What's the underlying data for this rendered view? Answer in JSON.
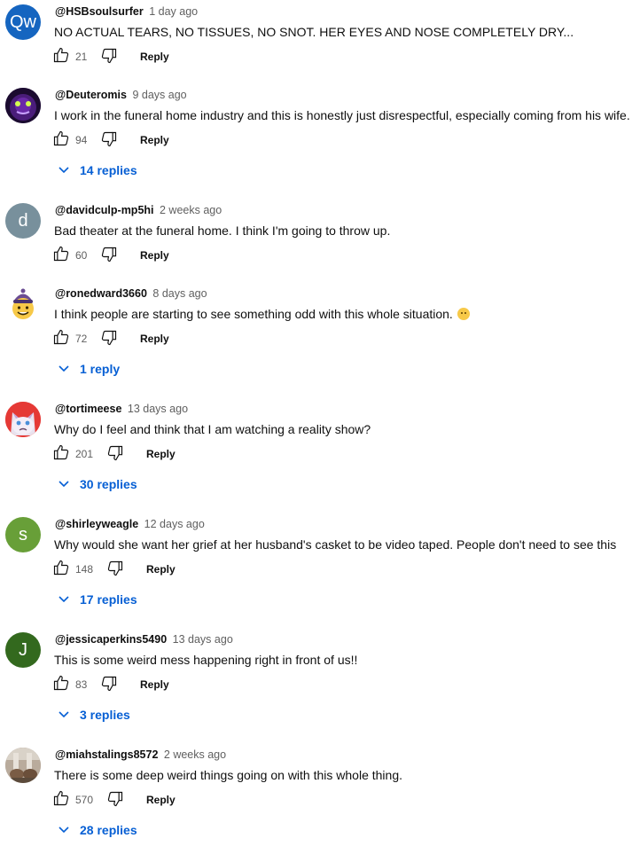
{
  "comments": [
    {
      "author": "@HSBsoulsurfer",
      "time": "1 day ago",
      "text": "NO ACTUAL TEARS, NO TISSUES, NO SNOT. HER EYES AND NOSE COMPLETELY DRY...",
      "likes": "21",
      "reply_label": "Reply",
      "replies": "",
      "avatar_letter": "Qw",
      "avatar_color": "#1565c0"
    },
    {
      "author": "@Deuteromis",
      "time": "9 days ago",
      "text": "I work in the funeral home industry and this is honestly just disrespectful, especially coming from his wife.",
      "likes": "94",
      "reply_label": "Reply",
      "replies": "14 replies",
      "avatar_letter": "",
      "avatar_color": "#2a1147"
    },
    {
      "author": "@davidculp-mp5hi",
      "time": "2 weeks ago",
      "text": "Bad theater at the funeral home. I think I'm going to throw up.",
      "likes": "60",
      "reply_label": "Reply",
      "replies": "",
      "avatar_letter": "d",
      "avatar_color": "#78909c"
    },
    {
      "author": "@ronedward3660",
      "time": "8 days ago",
      "text": "I think people are starting to see something odd with this whole situation.",
      "likes": "72",
      "reply_label": "Reply",
      "replies": "1 reply",
      "avatar_letter": "",
      "avatar_color": "#ffffff"
    },
    {
      "author": "@tortimeese",
      "time": "13 days ago",
      "text": "Why do I feel and think that I am watching a reality show?",
      "likes": "201",
      "reply_label": "Reply",
      "replies": "30 replies",
      "avatar_letter": "",
      "avatar_color": "#e53935"
    },
    {
      "author": "@shirleyweagle",
      "time": "12 days ago",
      "text": "Why would she want her grief at her husband's casket to be video taped.  People don't need to see this",
      "likes": "148",
      "reply_label": "Reply",
      "replies": "17 replies",
      "avatar_letter": "s",
      "avatar_color": "#689f38"
    },
    {
      "author": "@jessicaperkins5490",
      "time": "13 days ago",
      "text": "This is some weird mess happening right in front of us!!",
      "likes": "83",
      "reply_label": "Reply",
      "replies": "3 replies",
      "avatar_letter": "J",
      "avatar_color": "#33691e"
    },
    {
      "author": "@miahstalings8572",
      "time": "2 weeks ago",
      "text": "There is some deep weird things going on with this whole thing.",
      "likes": "570",
      "reply_label": "Reply",
      "replies": "28 replies",
      "avatar_letter": "",
      "avatar_color": "#9e8f80"
    }
  ],
  "icons": {
    "like": "thumb-up-icon",
    "dislike": "thumb-down-icon",
    "expand": "chevron-down-icon",
    "emoji": "raised-eyebrow-emoji-icon"
  },
  "colors": {
    "link": "#065fd4",
    "secondary_text": "#606060"
  }
}
